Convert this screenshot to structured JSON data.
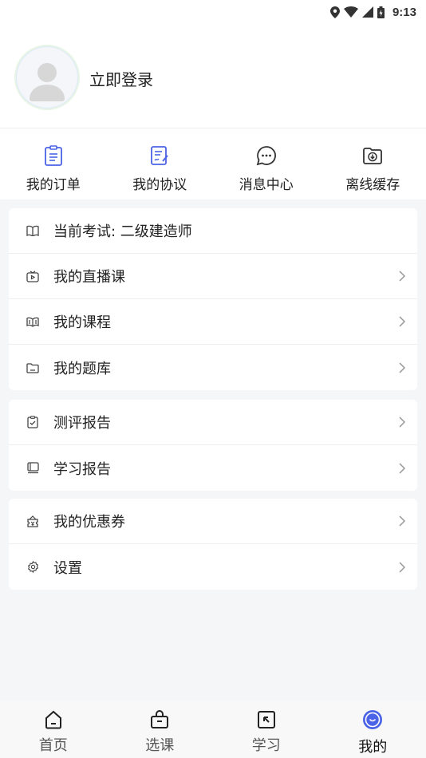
{
  "status_bar": {
    "time": "9:13"
  },
  "profile": {
    "login_label": "立即登录"
  },
  "quick_actions": [
    {
      "label": "我的订单",
      "icon": "orders-icon"
    },
    {
      "label": "我的协议",
      "icon": "agreement-icon"
    },
    {
      "label": "消息中心",
      "icon": "message-icon"
    },
    {
      "label": "离线缓存",
      "icon": "offline-cache-icon"
    }
  ],
  "section1": [
    {
      "label": "当前考试: 二级建造师",
      "icon": "book-open-icon",
      "chevron": false
    },
    {
      "label": "我的直播课",
      "icon": "live-tv-icon",
      "chevron": true
    },
    {
      "label": "我的课程",
      "icon": "course-book-icon",
      "chevron": true
    },
    {
      "label": "我的题库",
      "icon": "folder-icon",
      "chevron": true
    }
  ],
  "section2": [
    {
      "label": "测评报告",
      "icon": "clipboard-check-icon",
      "chevron": true
    },
    {
      "label": "学习报告",
      "icon": "report-book-icon",
      "chevron": true
    }
  ],
  "section3": [
    {
      "label": "我的优惠券",
      "icon": "coupon-icon",
      "chevron": true
    },
    {
      "label": "设置",
      "icon": "gear-icon",
      "chevron": true
    }
  ],
  "bottom_nav": [
    {
      "label": "首页",
      "icon": "home-icon",
      "active": false
    },
    {
      "label": "选课",
      "icon": "bag-icon",
      "active": false
    },
    {
      "label": "学习",
      "icon": "study-icon",
      "active": false
    },
    {
      "label": "我的",
      "icon": "profile-icon",
      "active": true
    }
  ],
  "colors": {
    "accent": "#4a63e7",
    "background": "#f5f6f8",
    "card": "#ffffff"
  }
}
